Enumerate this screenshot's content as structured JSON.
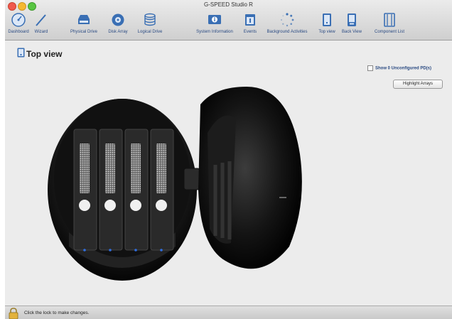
{
  "window": {
    "title": "G-SPEED Studio R"
  },
  "toolbar": {
    "items": [
      {
        "label": "Dashboard",
        "icon": "dashboard-gauge-icon"
      },
      {
        "label": "Wizard",
        "icon": "wand-icon"
      },
      {
        "label": "Physical Drive",
        "icon": "hard-drive-icon"
      },
      {
        "label": "Disk Array",
        "icon": "disk-array-icon"
      },
      {
        "label": "Logical Drive",
        "icon": "database-cylinder-icon"
      },
      {
        "label": "System Information",
        "icon": "info-monitor-icon"
      },
      {
        "label": "Events",
        "icon": "events-calendar-icon"
      },
      {
        "label": "Background Activities",
        "icon": "spinner-icon"
      },
      {
        "label": "Top view",
        "icon": "top-view-icon"
      },
      {
        "label": "Back View",
        "icon": "back-view-icon"
      },
      {
        "label": "Component List",
        "icon": "component-list-icon"
      }
    ]
  },
  "page": {
    "title": "Top view",
    "show_unconfigured_label": "Show 0 Unconfigured PD(s)",
    "show_unconfigured_checked": false,
    "highlight_button": "Highlight Arrays"
  },
  "status": {
    "text": "Click the lock to make changes."
  },
  "colors": {
    "link_blue": "#2a4a82",
    "drive_led": "#2f6ee0"
  }
}
